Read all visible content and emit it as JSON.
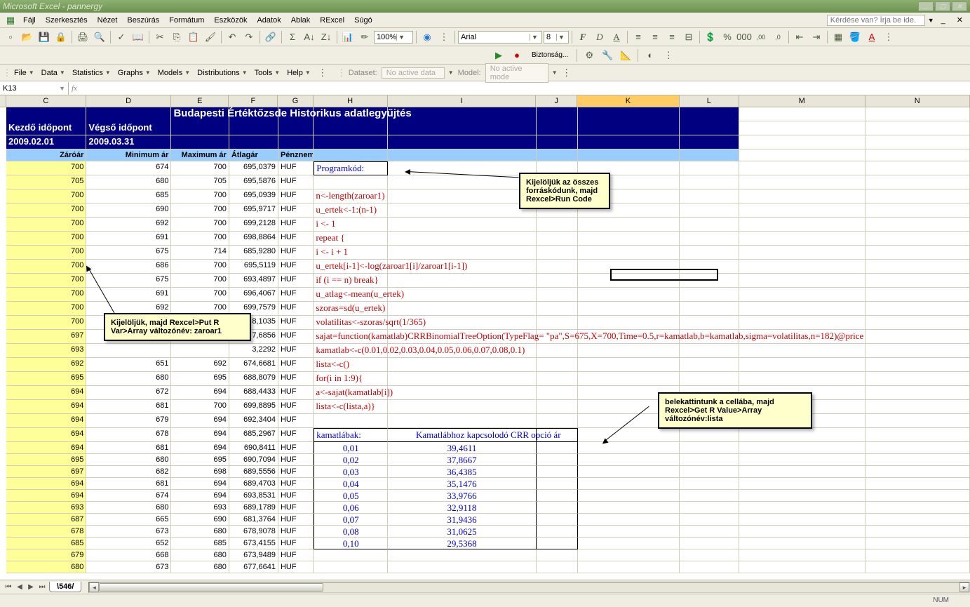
{
  "app_title": "Microsoft Excel - pannergy",
  "menu": {
    "items": [
      "Fájl",
      "Szerkesztés",
      "Nézet",
      "Beszúrás",
      "Formátum",
      "Eszközök",
      "Adatok",
      "Ablak",
      "RExcel",
      "Súgó"
    ],
    "question": "Kérdése van? Írja be ide."
  },
  "toolbar": {
    "font": "Arial",
    "font_size": "8",
    "zoom": "100%",
    "security": "Biztonság..."
  },
  "rexcel": {
    "items": [
      "File",
      "Data",
      "Statistics",
      "Graphs",
      "Models",
      "Distributions",
      "Tools",
      "Help"
    ],
    "dataset_label": "Dataset:",
    "dataset_value": "No active data",
    "model_label": "Model:",
    "model_value": "No active mode"
  },
  "name_box": "K13",
  "col_widths": {
    "C": 121,
    "D": 128,
    "E": 87,
    "F": 74,
    "G": 53,
    "H": 112,
    "I": 224,
    "J": 62,
    "K": 154,
    "L": 90,
    "M": 190,
    "N": 100
  },
  "columns": [
    "C",
    "D",
    "E",
    "F",
    "G",
    "H",
    "I",
    "J",
    "K",
    "L",
    "M",
    "N"
  ],
  "title_text": "Budapesti Értéktőzsde Historikus adatlegyűjtés",
  "subhdr": {
    "kezdo": "Kezdő időpont",
    "vegso": "Végső időpont",
    "date1": "2009.02.01",
    "date2": "2009.03.31"
  },
  "col_hdrs": [
    "Záróár",
    "Minimum ár",
    "Maximum ár",
    "Átlagár",
    "Pénznem"
  ],
  "programkod_label": "Programkód:",
  "data_rows": [
    {
      "z": 700,
      "min": 674,
      "max": 700,
      "avg": "695,0379",
      "cur": "HUF",
      "code": ""
    },
    {
      "z": 705,
      "min": 680,
      "max": 705,
      "avg": "695,5876",
      "cur": "HUF",
      "code": ""
    },
    {
      "z": 700,
      "min": 685,
      "max": 700,
      "avg": "695,0939",
      "cur": "HUF",
      "code": "n<-length(zaroar1)"
    },
    {
      "z": 700,
      "min": 690,
      "max": 700,
      "avg": "695,9717",
      "cur": "HUF",
      "code": "u_ertek<-1:(n-1)"
    },
    {
      "z": 700,
      "min": 692,
      "max": 700,
      "avg": "699,2128",
      "cur": "HUF",
      "code": "i <- 1"
    },
    {
      "z": 700,
      "min": 691,
      "max": 700,
      "avg": "698,8864",
      "cur": "HUF",
      "code": "repeat {"
    },
    {
      "z": 700,
      "min": 675,
      "max": 714,
      "avg": "685,9280",
      "cur": "HUF",
      "code": "i <- i + 1"
    },
    {
      "z": 700,
      "min": 686,
      "max": 700,
      "avg": "695,5119",
      "cur": "HUF",
      "code": "u_ertek[i-1]<-log(zaroar1[i]/zaroar1[i-1])"
    },
    {
      "z": 700,
      "min": 675,
      "max": 700,
      "avg": "693,4897",
      "cur": "HUF",
      "code": "if (i == n) break}"
    },
    {
      "z": 700,
      "min": 691,
      "max": 700,
      "avg": "696,4067",
      "cur": "HUF",
      "code": "u_atlag<-mean(u_ertek)"
    },
    {
      "z": 700,
      "min": 692,
      "max": 700,
      "avg": "699,7579",
      "cur": "HUF",
      "code": "szoras=sd(u_ertek)"
    },
    {
      "z": 700,
      "min": "",
      "max": "",
      "avg": "8,1035",
      "cur": "HUF",
      "code": "volatilitas<-szoras/sqrt(1/365)"
    },
    {
      "z": 697,
      "min": "",
      "max": "",
      "avg": "7,6856",
      "cur": "HUF",
      "code": "sajat=function(kamatlab)CRRBinomialTreeOption(TypeFlag= \"pa\",S=675,X=700,Time=0.5,r=kamatlab,b=kamatlab,sigma=volatilitas,n=182)@price"
    },
    {
      "z": 693,
      "min": "",
      "max": "",
      "avg": "3,2292",
      "cur": "HUF",
      "code": "kamatlab<-c(0.01,0.02,0.03,0.04,0.05,0.06,0.07,0.08,0.1)"
    },
    {
      "z": 692,
      "min": 651,
      "max": 692,
      "avg": "674,6681",
      "cur": "HUF",
      "code": "lista<-c()"
    },
    {
      "z": 695,
      "min": 680,
      "max": 695,
      "avg": "688,8079",
      "cur": "HUF",
      "code": "for(i in 1:9){"
    },
    {
      "z": 694,
      "min": 672,
      "max": 694,
      "avg": "688,4433",
      "cur": "HUF",
      "code": "a<-sajat(kamatlab[i])"
    },
    {
      "z": 694,
      "min": 681,
      "max": 700,
      "avg": "699,8895",
      "cur": "HUF",
      "code": "lista<-c(lista,a)}"
    },
    {
      "z": 694,
      "min": 679,
      "max": 694,
      "avg": "692,3404",
      "cur": "HUF",
      "code": ""
    }
  ],
  "kamat_hdr": {
    "h1": "kamatlábak:",
    "h2": "Kamatlábhoz kapcsolodó CRR opció ár"
  },
  "kamat_rows": [
    {
      "z": 694,
      "min": 678,
      "max": 694,
      "avg": "685,2967",
      "cur": "HUF",
      "k": "0,01",
      "v": "39,4611"
    },
    {
      "z": 694,
      "min": 681,
      "max": 694,
      "avg": "690,8411",
      "cur": "HUF",
      "k": "0,02",
      "v": "37,8667"
    },
    {
      "z": 695,
      "min": 680,
      "max": 695,
      "avg": "690,7094",
      "cur": "HUF",
      "k": "0,03",
      "v": "36,4385"
    },
    {
      "z": 697,
      "min": 682,
      "max": 698,
      "avg": "689,5556",
      "cur": "HUF",
      "k": "0,04",
      "v": "35,1476"
    },
    {
      "z": 694,
      "min": 681,
      "max": 694,
      "avg": "689,4703",
      "cur": "HUF",
      "k": "0,05",
      "v": "33,9766"
    },
    {
      "z": 694,
      "min": 674,
      "max": 694,
      "avg": "693,8531",
      "cur": "HUF",
      "k": "0,06",
      "v": "32,9118"
    },
    {
      "z": 693,
      "min": 680,
      "max": 693,
      "avg": "689,1789",
      "cur": "HUF",
      "k": "0,07",
      "v": "31,9436"
    },
    {
      "z": 687,
      "min": 665,
      "max": 690,
      "avg": "681,3764",
      "cur": "HUF",
      "k": "0,08",
      "v": "31,0625"
    },
    {
      "z": 678,
      "min": 673,
      "max": 680,
      "avg": "678,9078",
      "cur": "HUF",
      "k": "0,10",
      "v": "29,5368"
    }
  ],
  "tail_rows": [
    {
      "z": 685,
      "min": 652,
      "max": 685,
      "avg": "673,4155",
      "cur": "HUF"
    },
    {
      "z": 679,
      "min": 668,
      "max": 680,
      "avg": "673,9489",
      "cur": "HUF"
    },
    {
      "z": 680,
      "min": 673,
      "max": 680,
      "avg": "677,6641",
      "cur": "HUF"
    }
  ],
  "callouts": {
    "c1": "Kijelöljük az összes forráskódunk, majd Rexcel>Run Code",
    "c2": "Kijelöljük, majd Rexcel>Put R Var>Array változónév: zaroar1",
    "c3": "belekattintunk a cellába, majd Rexcel>Get R Value>Array változónév:lista"
  },
  "sheet_tab": "546",
  "status": "NUM"
}
